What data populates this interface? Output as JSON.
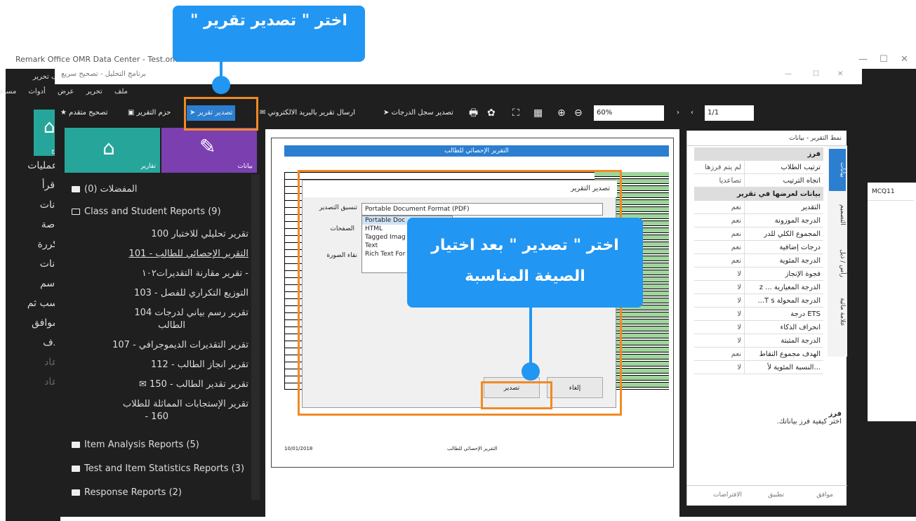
{
  "outer": {
    "title": "Remark Office OMR Data Center - Test.omr",
    "menu": "ملف  تحرير",
    "side_items": [
      "عمليات",
      "إقرأ",
      "انات",
      "اصة",
      "كررة",
      "انات",
      "اسم",
      "سب ثم",
      "موافق",
      "دف",
      "عاد",
      "عاد"
    ],
    "home_label": "النماذج",
    "grid_header": "MCQ11"
  },
  "inner": {
    "title": "برنامج التحليل - تصحيح سريع",
    "menu": [
      "ملف",
      "تحرير",
      "عرض",
      "أدوات",
      "مساعدة"
    ],
    "toolbar": {
      "advanced": "تصحيح متقدم",
      "package": "حزم التقرير",
      "export": "تصدير تقرير",
      "email": "ارسال تقرير بالبريد الالكتروني",
      "export_log": "تصدير سجل الدرجات",
      "zoom": "60%",
      "page": "1/1"
    },
    "tiles": {
      "reports": "تقارير",
      "data": "بيانات"
    }
  },
  "tree": {
    "favorites": "المفضلات (0)",
    "class_reports": "Class and Student Reports (9)",
    "items": [
      "تقرير تحليلي للاختبار 100",
      "التقرير الإحصائي للطالب - 101",
      "- تقرير مقارنة التقديرات١٠٢",
      "التوزيع التكراري للفصل - 103",
      "تقرير رسم بياني لدرجات 104",
      "الطالب",
      "تقرير التقديرات الديموجرافي - 107",
      "تقرير انجاز الطالب - 112",
      "تقرير تقدير الطالب - 150",
      "تقرير الإستجابات المماثلة للطلاب",
      "160 -"
    ],
    "item_analysis": "Item Analysis Reports (5)",
    "test_stats": "Test and Item Statistics Reports (3)",
    "response": "Response Reports (2)"
  },
  "report": {
    "title": "التقرير الإحصائي للطالب",
    "footer_left": "10/01/2018",
    "footer_mid": "التقرير الإحصائي للطالب"
  },
  "dialog": {
    "title": "تصدير التقرير",
    "format_label": "تنسيق التصدير",
    "pages_label": "الصفحات",
    "image_label": "نقاء الصورة",
    "selected": "Portable Document Format (PDF)",
    "options": [
      "Portable Doc",
      "HTML",
      "Tagged Imag",
      "Text",
      "Rich Text For"
    ],
    "export_btn": "تصدير",
    "cancel_btn": "إلغاء"
  },
  "panel": {
    "header": "نمط التقرير - بيانات",
    "rows": [
      {
        "k": "فرز",
        "v": "",
        "hdr": true
      },
      {
        "k": "ترتيب الطلاب",
        "v": "لم يتم فرزها"
      },
      {
        "k": "اتجاه الترتيب",
        "v": "تصاعديا"
      },
      {
        "k": "بيانات لعرضها في تقرير",
        "v": "",
        "hdr": true
      },
      {
        "k": "التقدير",
        "v": "نعم"
      },
      {
        "k": "الدرجة الموزونة",
        "v": "نعم"
      },
      {
        "k": "المجموع الكلي للدر",
        "v": "نعم"
      },
      {
        "k": "درجات إضافية",
        "v": "نعم"
      },
      {
        "k": "الدرجة المئوية",
        "v": "نعم"
      },
      {
        "k": "فجوة الإنجاز",
        "v": "لا"
      },
      {
        "k": "الدرجة المعيارية ... z",
        "v": "لا"
      },
      {
        "k": "الدرجة المحولة T s...",
        "v": "لا"
      },
      {
        "k": "ETS درجة",
        "v": "لا"
      },
      {
        "k": "انحراف الذكاء",
        "v": "لا"
      },
      {
        "k": "الدرجة المثبتة",
        "v": "لا"
      },
      {
        "k": "الهدف مجموع النقاط",
        "v": "نعم"
      },
      {
        "k": "...النسبة المئوية لأ",
        "v": "لا"
      }
    ],
    "tabs": [
      "بيانات",
      "التصميم",
      "رأس / ذيل",
      "علامة مائية"
    ],
    "desc_title": "فرز",
    "desc_text": "اختر كيفية فرز بياناتك.",
    "foot_defaults": "الافتراضات",
    "foot_apply": "تطبيق",
    "foot_ok": "موافق"
  },
  "callouts": {
    "top": "اختر \" تصدير تقرير \"",
    "middle": "اختر \" تصدير \" بعد اختيار الصيغة المناسبة"
  }
}
